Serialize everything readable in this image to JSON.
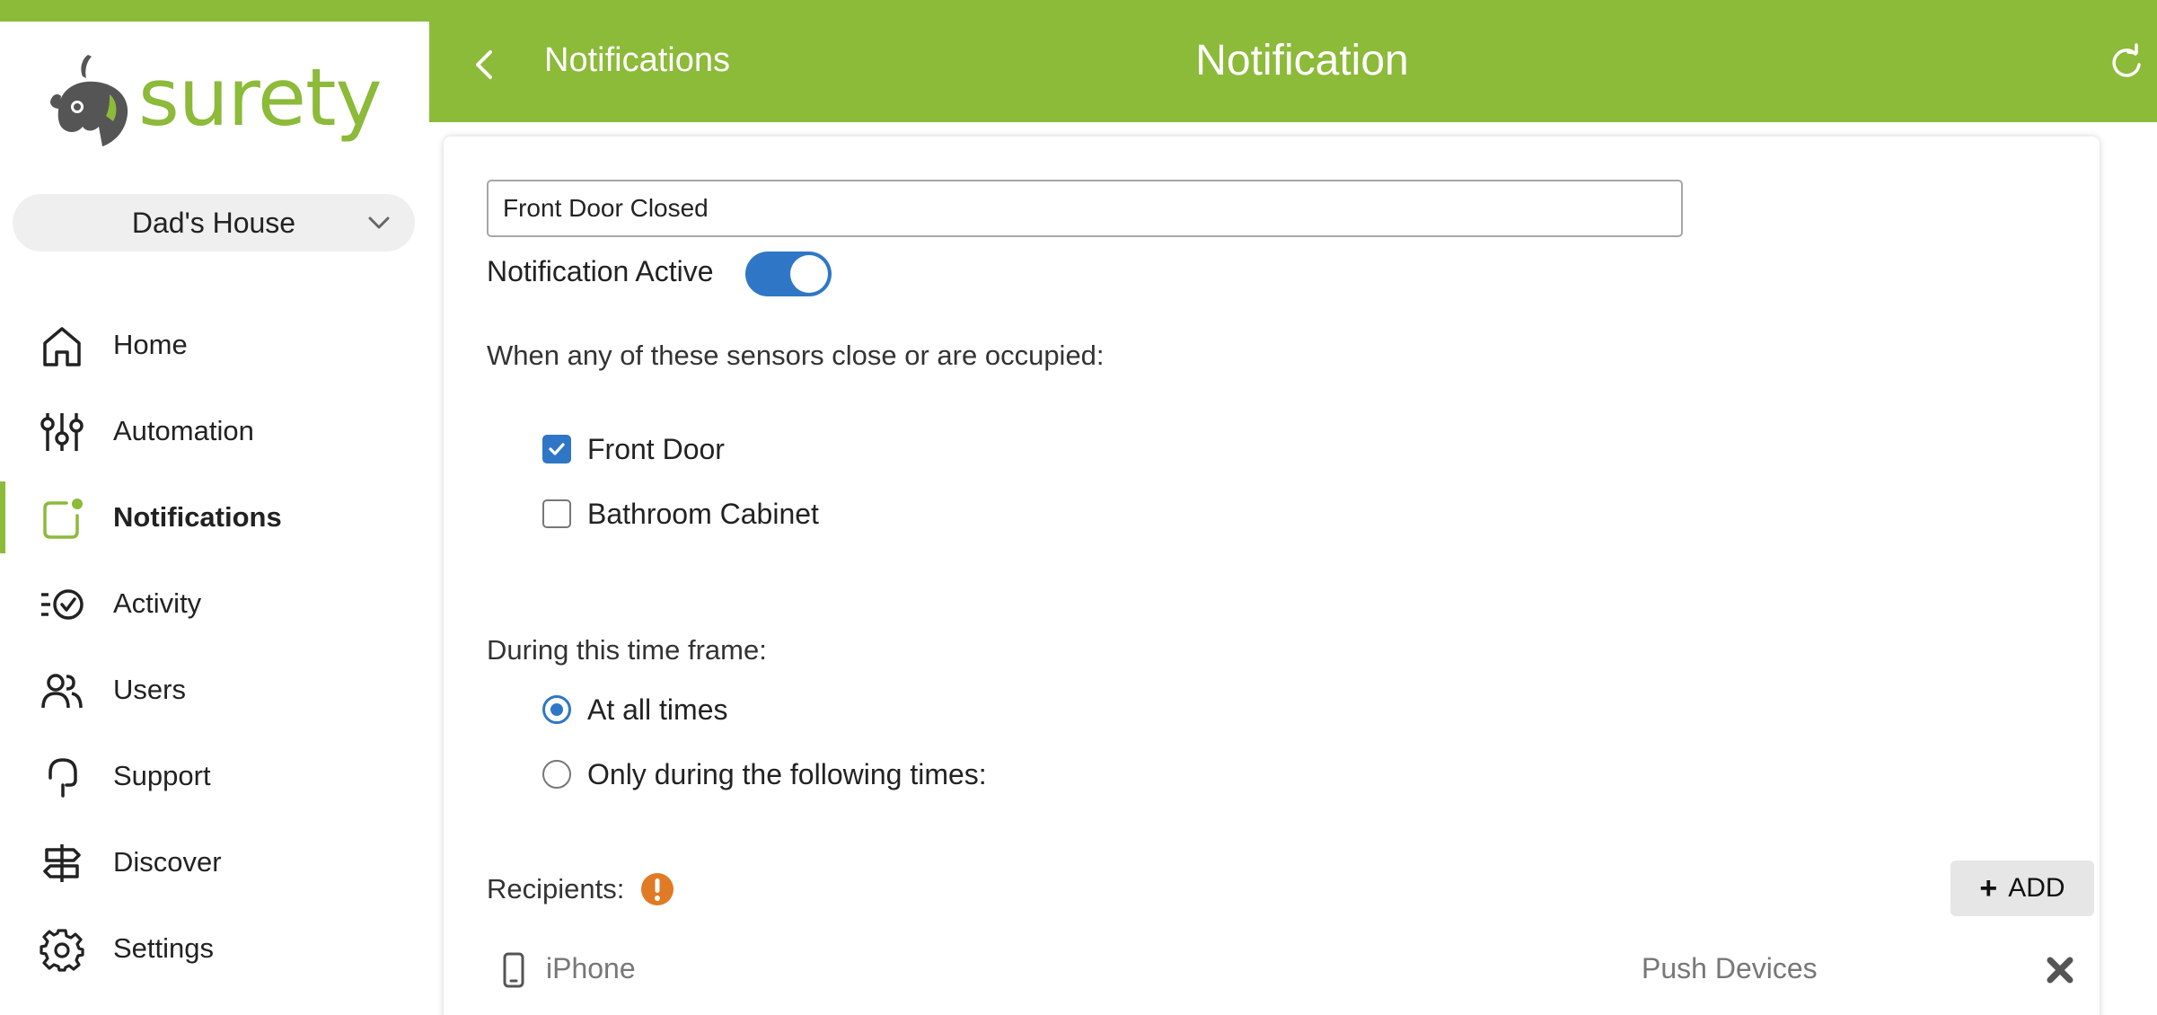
{
  "app": {
    "logo_text": "surety",
    "brand_color": "#8cba39",
    "accent_color": "#2f77c6",
    "warning_color": "#e07a24"
  },
  "location": {
    "label": "Dad's House",
    "icon": "chevron-down-icon"
  },
  "sidebar": {
    "items": [
      {
        "label": "Home",
        "icon": "home-icon",
        "active": false
      },
      {
        "label": "Automation",
        "icon": "sliders-icon",
        "active": false
      },
      {
        "label": "Notifications",
        "icon": "notification-icon",
        "active": true
      },
      {
        "label": "Activity",
        "icon": "activity-icon",
        "active": false
      },
      {
        "label": "Users",
        "icon": "users-icon",
        "active": false
      },
      {
        "label": "Support",
        "icon": "headset-icon",
        "active": false
      },
      {
        "label": "Discover",
        "icon": "signpost-icon",
        "active": false
      },
      {
        "label": "Settings",
        "icon": "gear-icon",
        "active": false
      }
    ]
  },
  "header": {
    "back_label": "Notifications",
    "title": "Notification",
    "back_icon": "chevron-left-icon",
    "refresh_icon": "refresh-icon"
  },
  "form": {
    "name_value": "Front Door Closed",
    "active_label": "Notification Active",
    "active": true,
    "sensors_label": "When any of these sensors close or are occupied:",
    "sensors": [
      {
        "label": "Front Door",
        "checked": true
      },
      {
        "label": "Bathroom Cabinet",
        "checked": false
      }
    ],
    "timeframe_label": "During this time frame:",
    "timeframes": [
      {
        "label": "At all times",
        "selected": true
      },
      {
        "label": "Only during the following times:",
        "selected": false
      }
    ],
    "recipients_label": "Recipients:",
    "recipients_warning_icon": "warning-icon",
    "add_label": "ADD",
    "recipients": [
      {
        "name": "iPhone",
        "type": "Push Devices",
        "icon": "phone-icon",
        "remove_icon": "close-icon"
      }
    ]
  }
}
